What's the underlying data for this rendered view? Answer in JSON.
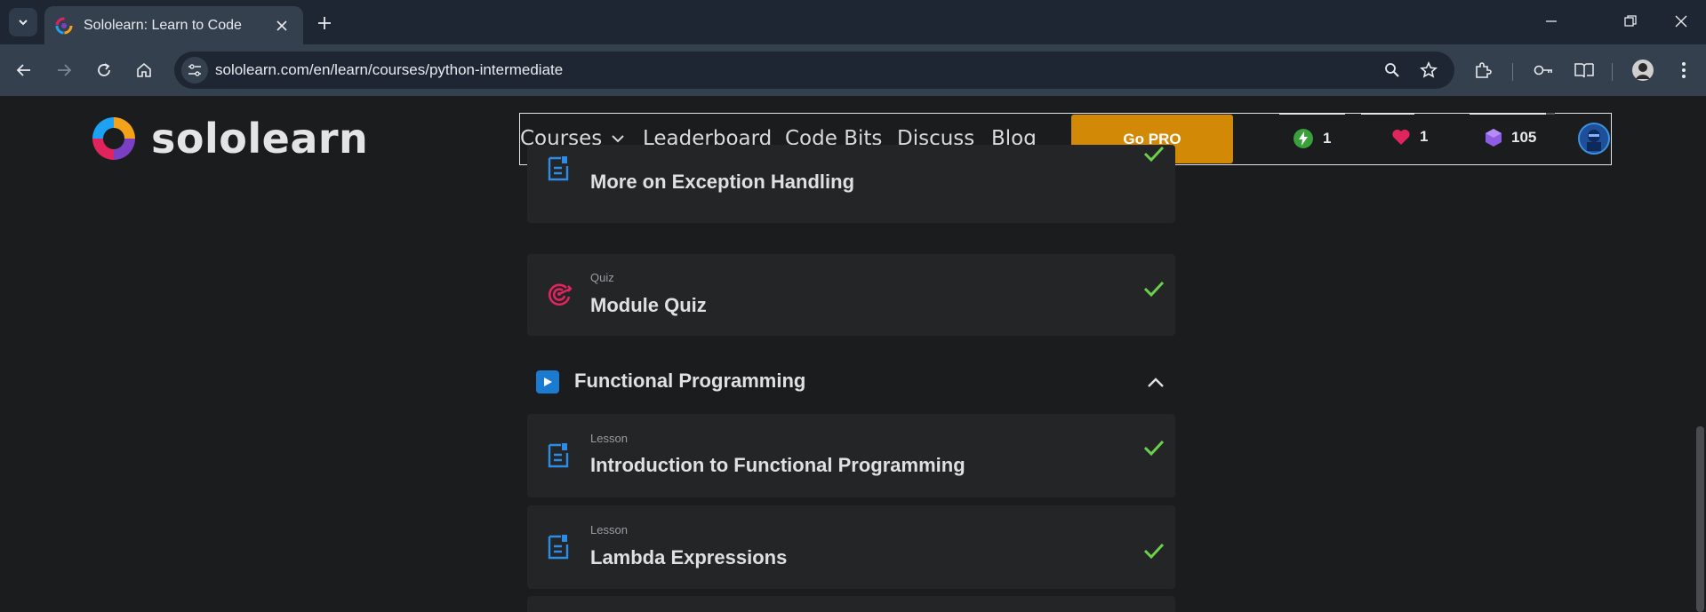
{
  "browser": {
    "tab_title": "Sololearn: Learn to Code",
    "url": "sololearn.com/en/learn/courses/python-intermediate"
  },
  "site": {
    "brand": "sololearn",
    "nav": {
      "courses": "Courses",
      "leaderboard": "Leaderboard",
      "code_bits": "Code Bits",
      "discuss": "Discuss",
      "blog": "Blog",
      "go_pro": "Go PRO"
    },
    "stats": {
      "streak": "1",
      "hearts": "1",
      "bits": "105"
    }
  },
  "lessons_before": [
    {
      "kind": "",
      "name": "More on Exception Handling",
      "completed": true
    },
    {
      "kind": "Quiz",
      "name": "Module Quiz",
      "completed": true
    }
  ],
  "section": {
    "title": "Functional Programming",
    "expanded": true
  },
  "lessons_after": [
    {
      "kind": "Lesson",
      "name": "Introduction to Functional Programming",
      "completed": true
    },
    {
      "kind": "Lesson",
      "name": "Lambda Expressions",
      "completed": true
    }
  ],
  "colors": {
    "accent_pro": "#d28a06",
    "check": "#6cd14a",
    "lesson_icon": "#2d8ce6",
    "quiz_icon": "#e0245e",
    "background": "#1b1c1e"
  }
}
